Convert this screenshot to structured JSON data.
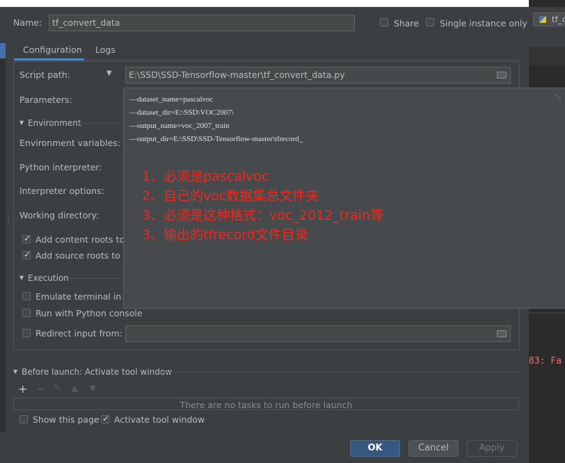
{
  "dialog": {
    "name_label": "Name:",
    "name_value": "tf_convert_data",
    "share_label": "Share",
    "single_instance_label": "Single instance only"
  },
  "tabs": [
    {
      "label": "Configuration"
    },
    {
      "label": "Logs"
    }
  ],
  "config": {
    "script_path_label": "Script path:",
    "script_path_value": "E:\\SSD\\SSD-Tensorflow-master\\tf_convert_data.py",
    "parameters_label": "Parameters:",
    "environment_header": "Environment",
    "env_vars_label": "Environment variables:",
    "python_interpreter_label": "Python interpreter:",
    "interpreter_options_label": "Interpreter options:",
    "working_dir_label": "Working directory:",
    "add_content_roots_label": "Add content roots to",
    "add_source_roots_label": "Add source roots to P",
    "execution_header": "Execution",
    "emulate_terminal_label": "Emulate terminal in ou",
    "run_python_console_label": "Run with Python console",
    "redirect_input_label": "Redirect input from:"
  },
  "params_popup": {
    "lines": [
      "—dataset_name=pascalvoc",
      "—dataset_dir=E:\\SSD\\VOC2007\\",
      "—output_name=voc_2007_train",
      "—output_dir=E:\\SSD\\SSD-Tensorflow-master\\tfrecord_"
    ],
    "annotations": [
      "1、必须是pascalvoc",
      "2、自己的voc数据集总文件夹",
      "3、必须是这种格式：voc_2012_train等",
      "3、输出的tfrecord文件目录"
    ]
  },
  "before_launch": {
    "header": "Before launch: Activate tool window",
    "empty_text": "There are no tasks to run before launch",
    "show_page_label": "Show this page",
    "activate_tool_label": "Activate tool window"
  },
  "buttons": {
    "ok": "OK",
    "cancel": "Cancel",
    "apply": "Apply"
  },
  "background": {
    "editor_tab": "tf_c",
    "console_text": "83: Fa"
  },
  "colors": {
    "dialog_bg": "#3c3f41",
    "accent": "#4a88c7",
    "primary_button": "#365880",
    "annotation_red": "#f0281e",
    "error_red": "#ff6b68"
  },
  "state": {
    "share_checked": false,
    "single_instance_checked": false,
    "add_content_roots_checked": true,
    "add_source_roots_checked": true,
    "emulate_terminal_checked": false,
    "run_python_console_checked": false,
    "redirect_input_checked": false,
    "show_page_checked": false,
    "activate_tool_checked": true
  }
}
